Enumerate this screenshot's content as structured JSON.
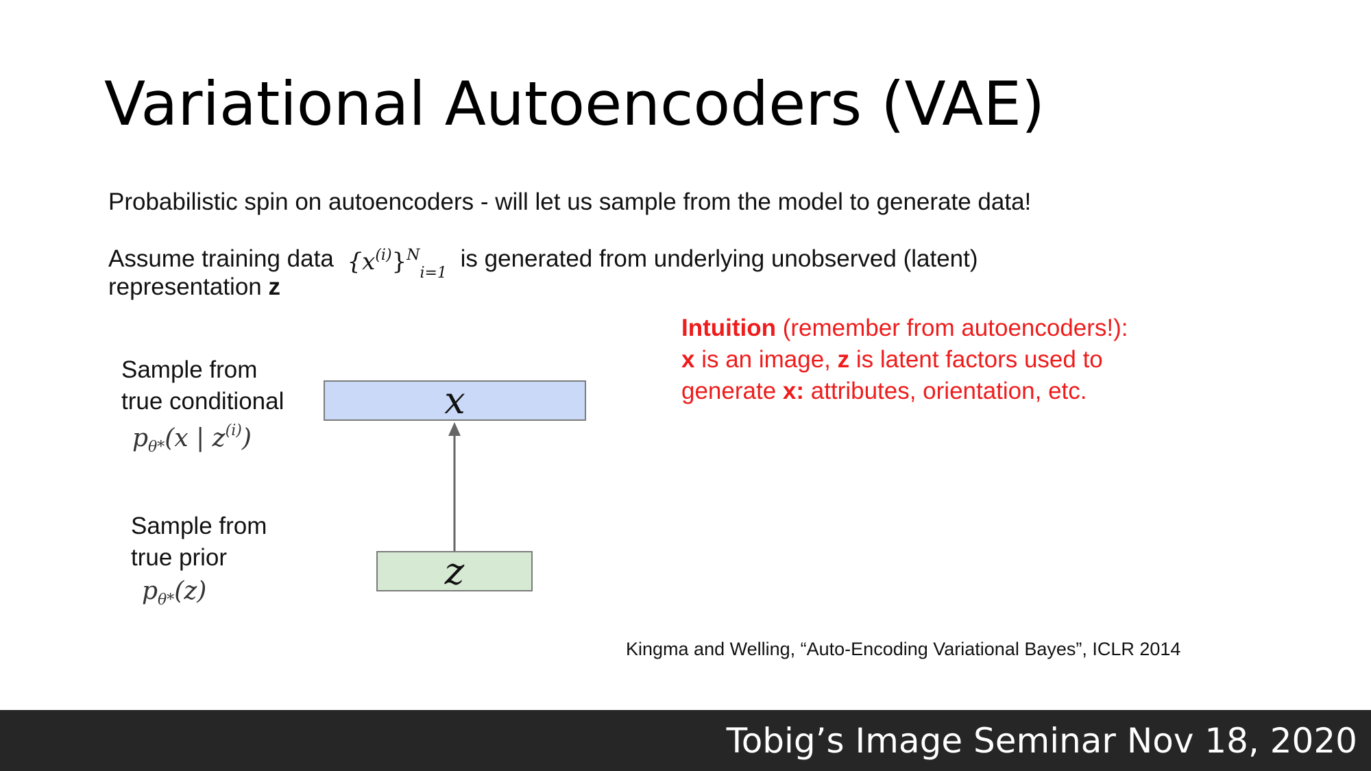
{
  "slide": {
    "title": "Variational Autoencoders (VAE)",
    "line1": "Probabilistic spin on autoencoders - will let us sample from the model to generate data!",
    "line2_prefix": "Assume training data",
    "line2_math_base": "{x",
    "line2_math_sup": "(i)",
    "line2_math_close": "}",
    "line2_math_sup_n": "N",
    "line2_math_sub": "i=1",
    "line2_suffix": "is generated from underlying unobserved (latent)",
    "line3_prefix": "representation",
    "line3_bold": "z"
  },
  "diagram": {
    "upper_label_1": "Sample from",
    "upper_label_2": "true conditional",
    "upper_formula_p": "p",
    "upper_formula_sub": "θ*",
    "upper_formula_args": "(x | z",
    "upper_formula_sup": "(i)",
    "upper_formula_close": ")",
    "lower_label_1": "Sample from",
    "lower_label_2": "true prior",
    "lower_formula_p": "p",
    "lower_formula_sub": "θ*",
    "lower_formula_args": "(z)",
    "box_x_label": "x",
    "box_z_label": "z",
    "colors": {
      "x_box": "#c9d9f7",
      "z_box": "#d6ead3",
      "arrow": "#666666"
    }
  },
  "intuition": {
    "heading": "Intuition",
    "line1_rest": " (remember from autoencoders!):",
    "line2_b1": "x",
    "line2_t1": " is an image, ",
    "line2_b2": "z",
    "line2_t2": " is latent factors used to",
    "line3_t1": "generate ",
    "line3_b1": "x:",
    "line3_t2": " attributes, orientation, etc.",
    "color": "#ee1c1c"
  },
  "citation": "Kingma and Welling, “Auto-Encoding Variational Bayes”, ICLR 2014",
  "footer": {
    "text": "Tobig’s Image Seminar Nov 18, 2020",
    "background": "#262626"
  }
}
